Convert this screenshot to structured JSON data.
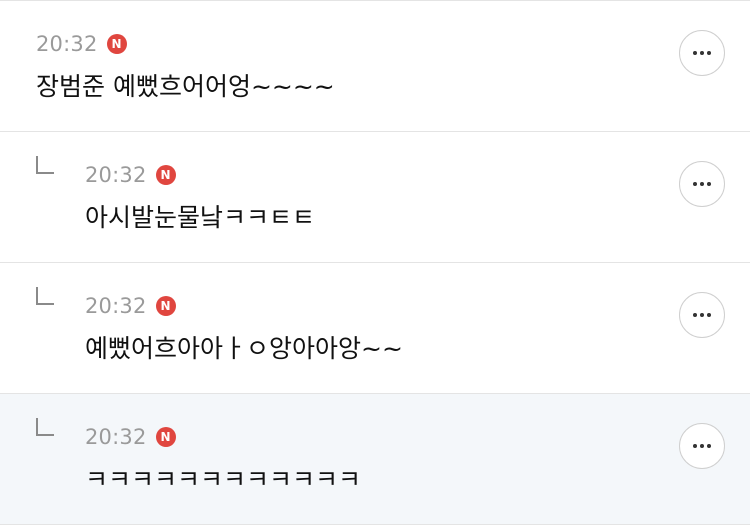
{
  "comments": [
    {
      "time": "20:32",
      "badge": "N",
      "text": "장범준 예뻤흐어어엉~~~~",
      "is_reply": false,
      "highlighted": false
    },
    {
      "time": "20:32",
      "badge": "N",
      "text": "아시발눈물낰ㅋㅋㅌㅌ",
      "is_reply": true,
      "highlighted": false
    },
    {
      "time": "20:32",
      "badge": "N",
      "text": "예뻤어흐아아ㅏㅇ앙아아앙~~",
      "is_reply": true,
      "highlighted": false
    },
    {
      "time": "20:32",
      "badge": "N",
      "text": "ㅋㅋㅋㅋㅋㅋㅋㅋㅋㅋㅋㅋ",
      "is_reply": true,
      "highlighted": true
    }
  ],
  "icons": {
    "more": "more-options-icon",
    "reply": "reply-arrow-icon"
  },
  "colors": {
    "badge": "#e0463f",
    "highlight_bg": "#f4f7fa",
    "divider": "#e4e4e4"
  }
}
